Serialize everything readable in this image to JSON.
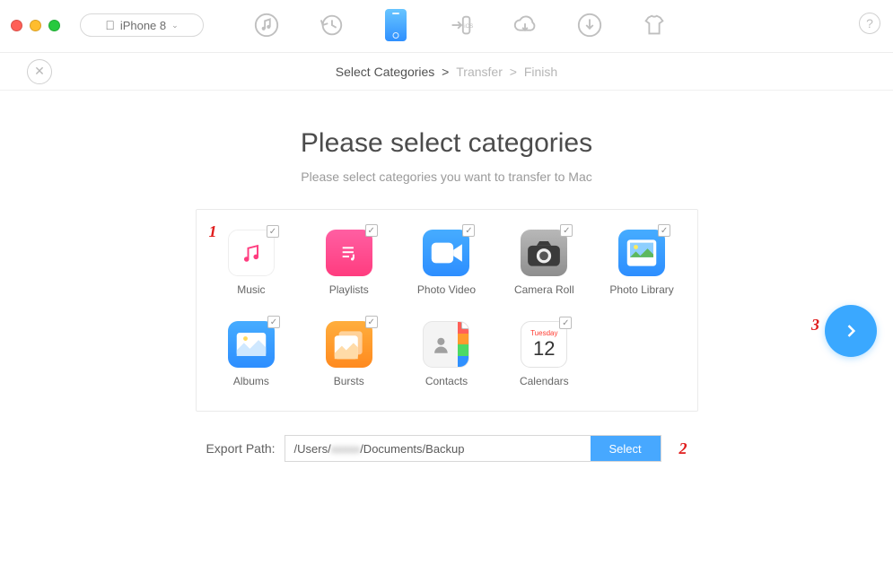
{
  "toolbar": {
    "device_label": "iPhone 8"
  },
  "breadcrumb": {
    "step1": "Select Categories",
    "step2": "Transfer",
    "step3": "Finish"
  },
  "hero": {
    "title": "Please select categories",
    "subtitle": "Please select categories you want to transfer to Mac"
  },
  "categories": [
    {
      "label": "Music"
    },
    {
      "label": "Playlists"
    },
    {
      "label": "Photo Video"
    },
    {
      "label": "Camera Roll"
    },
    {
      "label": "Photo Library"
    },
    {
      "label": "Albums"
    },
    {
      "label": "Bursts"
    },
    {
      "label": "Contacts"
    },
    {
      "label": "Calendars"
    }
  ],
  "calendar_tile": {
    "weekday": "Tuesday",
    "date": "12"
  },
  "export": {
    "label": "Export Path:",
    "path_prefix": "/Users/",
    "path_mid_blurred": "xxxxx",
    "path_suffix": "/Documents/Backup",
    "select_label": "Select"
  },
  "annotations": {
    "a1": "1",
    "a2": "2",
    "a3": "3"
  }
}
